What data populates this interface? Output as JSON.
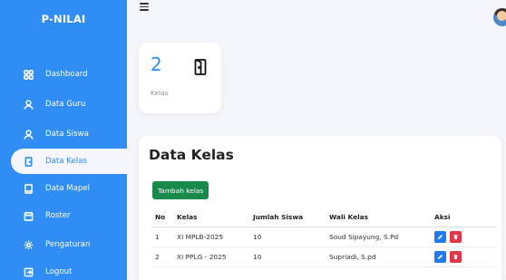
{
  "sidebar": {
    "brand": "P-NILAI",
    "items": [
      {
        "label": "Dashboard",
        "icon": "dashboard-icon"
      },
      {
        "label": "Data Guru",
        "icon": "user-icon"
      },
      {
        "label": "Data Siswa",
        "icon": "user-icon"
      },
      {
        "label": "Data Kelas",
        "icon": "door-icon",
        "active": true
      },
      {
        "label": "Data Mapel",
        "icon": "book-icon"
      },
      {
        "label": "Roster",
        "icon": "calendar-icon"
      },
      {
        "label": "Pengaturan",
        "icon": "gear-icon"
      },
      {
        "label": "Logout",
        "icon": "logout-icon"
      }
    ]
  },
  "stat": {
    "count": "2",
    "label": "Kelas",
    "icon": "door-icon"
  },
  "panel": {
    "title": "Data Kelas",
    "add_button": "Tambah kelas",
    "columns": [
      "No",
      "Kelas",
      "Jumlah Siswa",
      "Wali Kelas",
      "Aksi"
    ],
    "rows": [
      {
        "no": "1",
        "kelas": "XI MPLB-2025",
        "jumlah": "10",
        "wali": "Soud Sipayung, S.Pd"
      },
      {
        "no": "2",
        "kelas": "XI PPLG - 2025",
        "jumlah": "10",
        "wali": "Supriadi, S.pd"
      }
    ]
  },
  "colors": {
    "sidebar": "#2f8df3",
    "primary": "#2f8df3",
    "success": "#1a8a4c",
    "edit": "#1e7cf0",
    "delete": "#e23648",
    "background": "#f4f6fb"
  }
}
